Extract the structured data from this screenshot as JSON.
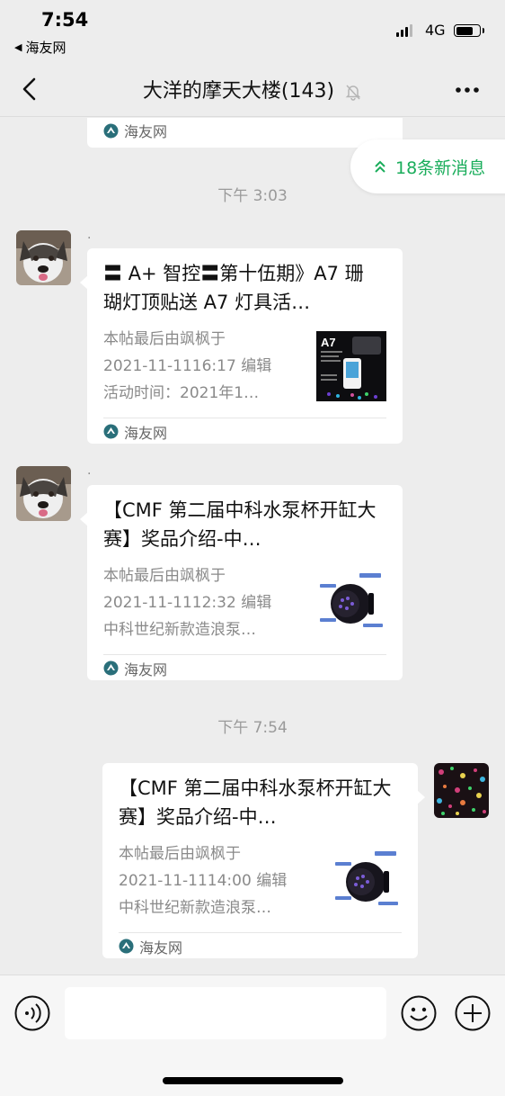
{
  "status_bar": {
    "time": "7:54",
    "back_app": "海友网",
    "network": "4G"
  },
  "nav": {
    "title": "大洋的摩天大楼(143)"
  },
  "new_messages_pill": {
    "label": "18条新消息"
  },
  "messages": {
    "top_card_source": "海友网",
    "timestamp_1": "下午 3:03",
    "timestamp_2": "下午 7:54",
    "msg1": {
      "sender": ".",
      "title": "〓 A+ 智控〓第十伍期》A7 珊 瑚灯顶贴送 A7 灯具活…",
      "desc": "本帖最后由飒枫于\n2021-11-1116:17 编辑\n活动时间：2021年1…",
      "source": "海友网",
      "thumb_label": "A7"
    },
    "msg2": {
      "sender": ".",
      "title": "【CMF 第二届中科水泵杯开缸大赛】奖品介绍-中…",
      "desc": "本帖最后由飒枫于\n2021-11-1112:32 编辑\n中科世纪新款造浪泵…",
      "source": "海友网"
    },
    "msg3": {
      "title": "【CMF 第二届中科水泵杯开缸大赛】奖品介绍-中…",
      "desc": "本帖最后由飒枫于\n2021-11-1114:00 编辑\n中科世纪新款造浪泵…",
      "source": "海友网"
    }
  },
  "colors": {
    "background": "#ededed",
    "accent_green": "#1aad5b",
    "card": "#ffffff"
  },
  "icons": {
    "back": "chevron-left-icon",
    "mute": "bell-slash-icon",
    "more": "more-dots-icon",
    "source": "haiyou-logo-icon",
    "new_msg": "double-chevron-up-icon",
    "voice": "voice-icon",
    "emoji": "emoji-icon",
    "plus": "plus-icon"
  }
}
